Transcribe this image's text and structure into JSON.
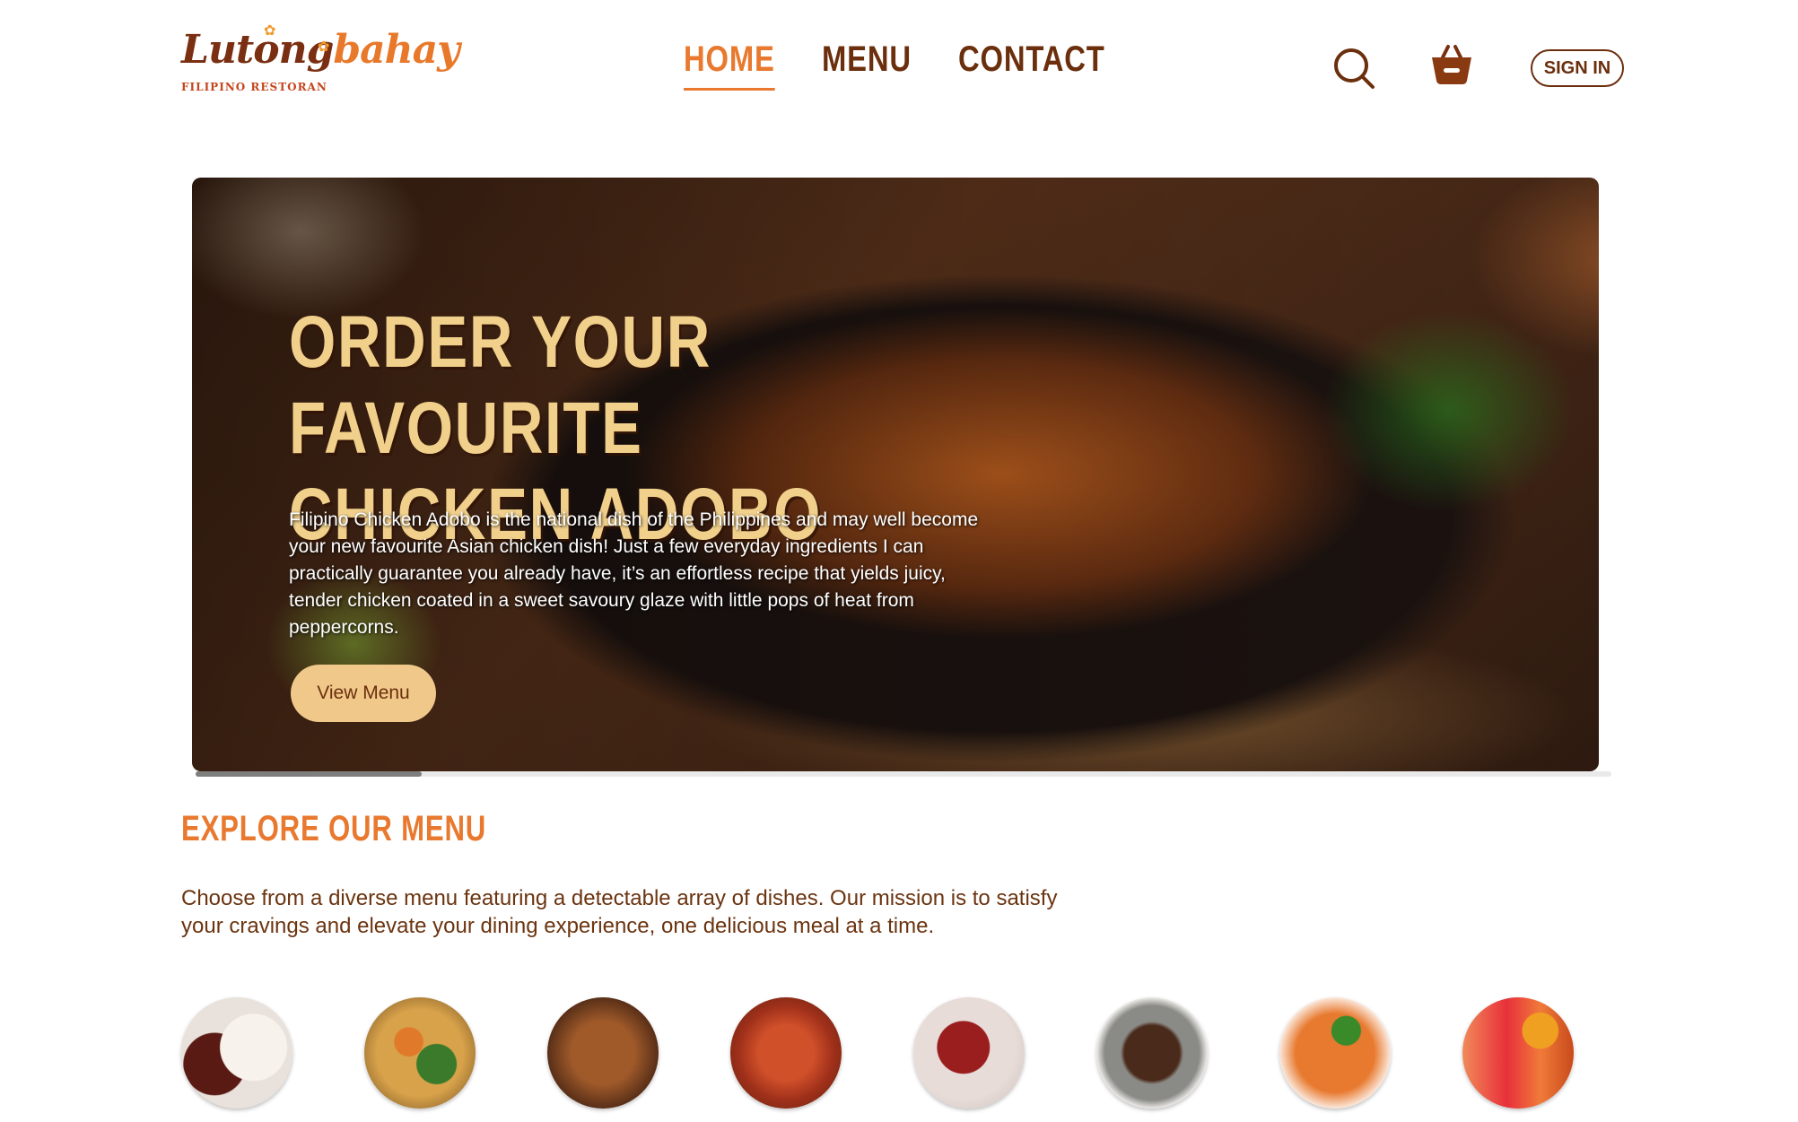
{
  "brand": {
    "logo_main_a": "Lutong",
    "logo_main_b": "bahay",
    "logo_sub": "FILIPINO RESTORAN"
  },
  "nav": {
    "items": [
      {
        "label": "HOME",
        "active": true
      },
      {
        "label": "MENU",
        "active": false
      },
      {
        "label": "CONTACT",
        "active": false
      }
    ]
  },
  "header": {
    "search_icon": "search-icon",
    "cart_icon": "shopping-basket-icon",
    "signin_label": "SIGN IN"
  },
  "hero": {
    "title": "ORDER YOUR FAVOURITE CHICKEN ADOBO",
    "description": "Filipino Chicken Adobo is the national dish of the Philippines and may well become your new favourite Asian chicken dish! Just a few everyday ingredients I can practically guarantee you already have, it’s an effortless recipe that yields juicy, tender chicken coated in a sweet savoury glaze with little pops of heat from peppercorns.",
    "button_label": "View Menu"
  },
  "explore": {
    "title": "EXPLORE OUR MENU",
    "description": "Choose from a diverse menu featuring a detectable array of dishes. Our mission is to satisfy your cravings and elevate your dining experience, one delicious meal at a time."
  },
  "colors": {
    "accent": "#e8792f",
    "brown": "#6b2f0d",
    "hero_title": "#f1d08b",
    "button": "#f0c98a"
  }
}
